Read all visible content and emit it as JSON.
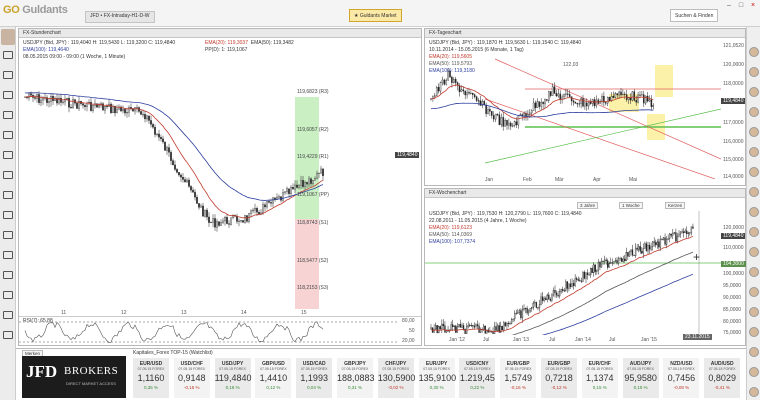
{
  "app": {
    "brand_prefix": "GO",
    "brand_name": "Guldants"
  },
  "topbar": {
    "tab_label": "JFD • FX-Intraday-H1-D-W",
    "student_button": "Guldants Market",
    "search_button": "Suchen & Finden"
  },
  "panels": {
    "hourly": {
      "title": "FX-Stundenchart",
      "legend": [
        "USDJPY (Bid, JPY) : 119,4040  H: 119,5430  L: 119,3200  C: 119,4840",
        "EMA(100): 119,4640",
        "08.05.2015 09:00 - 09:00 (1 Woche, 1 Minute)"
      ],
      "legend_right": [
        "EMA(20): 119,3037",
        "EMA(50): 119,3482",
        "PP(D): 1: 119,1067"
      ],
      "levels": [
        "119,6823 (R3)",
        "119,6057 (R2)",
        "119,4229 (R1)",
        "119,1067 (PP)",
        "118,8743 (S1)",
        "118,5477 (S2)",
        "118,2153 (S3)"
      ],
      "price_tag": "119,4840",
      "x_labels": [
        "11",
        "12",
        "13",
        "14",
        "15"
      ],
      "rsi_label": "RSI(7): 65,88",
      "rsi_ticks": [
        "80,00",
        "50",
        "20,00"
      ]
    },
    "daily": {
      "title": "FX-Tageschart",
      "legend": [
        "USDJPY (Bid, JPY) : 119,1870  H: 119,5630  L: 119,1540  C: 119,4840",
        "10.11.2014 - 15.05.2015 (6 Monate, 1 Tag)",
        "EMA(20): 119,5605",
        "EMA(50): 119,5793",
        "EMA(100): 119,3180"
      ],
      "y_labels": [
        "121,0520",
        "120,0000",
        "119,4840",
        "118,0000",
        "117,0000",
        "116,0000",
        "115,0000",
        "114,0000"
      ],
      "x_labels": [
        "Jan",
        "Feb",
        "Mär",
        "Apr",
        "Mai"
      ],
      "peak_label": "122,03"
    },
    "weekly": {
      "title": "FX-Wochenchart",
      "legend": [
        "USDJPY (Bid, JPY) : 119,7530  H: 120,2790  L: 119,7600  C: 119,4840",
        "22.08.2011 - 11.05.2015 (4 Jahre, 1 Woche)",
        "EMA(20): 119,6123",
        "EMA(50): 114,0369",
        "EMA(100): 107,7374"
      ],
      "toolbar": [
        "3 Jahre",
        "1 Woche",
        "Kerzen"
      ],
      "y_labels": [
        "120,0000",
        "119,4840",
        "110,0000",
        "104,3000",
        "100,0000",
        "95,0000",
        "90,0000",
        "85,0000",
        "80,0000",
        "75,0000"
      ],
      "x_labels": [
        "Jan '12",
        "Jul",
        "Jan '13",
        "Jul",
        "Jan '14",
        "Jul",
        "Jan '15"
      ],
      "date_tag": "23.11.2015"
    }
  },
  "sidebar": {
    "bottom_label": "Merken"
  },
  "bottom": {
    "broker_big": "JFD",
    "broker_word": "BROKERS",
    "broker_sub": "DIRECT MARKET ACCESS",
    "tiles_title": "Kapitales_Forex TOP-15 (Watchlist)",
    "tiles": [
      {
        "name": "EUR/USD",
        "date": "07.05.15 FOREX",
        "price": "1,1160",
        "chg": "0,35 %",
        "color": "#3a8a3a"
      },
      {
        "name": "USD/CHF",
        "date": "07.05.15 FOREX",
        "price": "0,9148",
        "chg": "-0,15 %",
        "color": "#c0392b"
      },
      {
        "name": "USD/JPY",
        "date": "07.05.15 FOREX",
        "price": "119,4840",
        "chg": "0,18 %",
        "color": "#3a8a3a"
      },
      {
        "name": "GBP/USD",
        "date": "07.05.15 FOREX",
        "price": "1,4410",
        "chg": "0,12 %",
        "color": "#3a8a3a"
      },
      {
        "name": "USD/CAD",
        "date": "07.05.15 FOREX",
        "price": "1,1993",
        "chg": "0,04 %",
        "color": "#3a8a3a"
      },
      {
        "name": "GBP/JPY",
        "date": "07.05.15 FOREX",
        "price": "188,0883",
        "chg": "0,31 %",
        "color": "#3a8a3a"
      },
      {
        "name": "CHF/JPY",
        "date": "07.05.15 FOREX",
        "price": "130,5900",
        "chg": "-0,02 %",
        "color": "#c0392b"
      },
      {
        "name": "EUR/JPY",
        "date": "07.05.15 FOREX",
        "price": "135,9100",
        "chg": "0,30 %",
        "color": "#3a8a3a"
      },
      {
        "name": "USD/CNY",
        "date": "07.05.15 FOREX",
        "price": "1.219,45",
        "chg": "0,22 %",
        "color": "#3a8a3a"
      },
      {
        "name": "EUR/GBP",
        "date": "07.05.15 FOREX",
        "price": "1,5749",
        "chg": "-0,16 %",
        "color": "#c0392b"
      },
      {
        "name": "EUR/GBP",
        "date": "07.05.15 FOREX",
        "price": "0,7218",
        "chg": "-0,12 %",
        "color": "#c0392b"
      },
      {
        "name": "EUR/CHF",
        "date": "07.05.15 FOREX",
        "price": "1,1374",
        "chg": "0,15 %",
        "color": "#3a8a3a"
      },
      {
        "name": "AUD/JPY",
        "date": "07.05.15 FOREX",
        "price": "95,9580",
        "chg": "0,15 %",
        "color": "#3a8a3a"
      },
      {
        "name": "NZD/USD",
        "date": "07.05.15 FOREX",
        "price": "0,7456",
        "chg": "-0,08 %",
        "color": "#c0392b"
      },
      {
        "name": "AUD/USD",
        "date": "07.05.15 FOREX",
        "price": "0,8029",
        "chg": "-0,41 %",
        "color": "#c0392b"
      }
    ]
  },
  "chart_data": [
    {
      "type": "line",
      "title": "FX-Stundenchart",
      "series_name": "USDJPY hourly",
      "pivot_levels": {
        "R3": 119.6823,
        "R2": 119.6057,
        "R1": 119.4229,
        "PP": 119.1067,
        "S1": 118.8743,
        "S2": 118.5477,
        "S3": 118.2153
      },
      "close": 119.484
    },
    {
      "type": "line",
      "title": "FX-Tageschart",
      "x": [
        "Jan",
        "Feb",
        "Mär",
        "Apr",
        "Mai"
      ],
      "close": 119.484,
      "high_marker": 122.03
    },
    {
      "type": "line",
      "title": "FX-Wochenchart",
      "x": [
        "Jan '12",
        "Jul",
        "Jan '13",
        "Jul",
        "Jan '14",
        "Jul",
        "Jan '15"
      ],
      "close": 119.484
    }
  ]
}
